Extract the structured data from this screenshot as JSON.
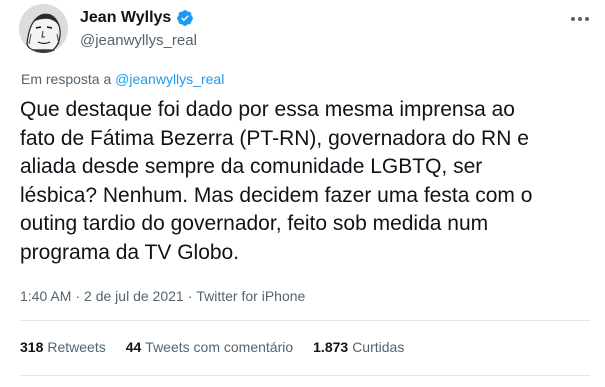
{
  "author": {
    "display_name": "Jean Wyllys",
    "handle": "@jeanwyllys_real",
    "verified": true,
    "avatar_icon": "avatar-portrait",
    "verified_icon": "verified-badge-icon"
  },
  "reply": {
    "prefix": "Em resposta a",
    "to_handle": "@jeanwyllys_real"
  },
  "tweet": {
    "text": "Que destaque foi dado por essa mesma imprensa ao\nfato de Fátima Bezerra (PT-RN), governadora do RN e\naliada desde sempre da comunidade LGBTQ, ser\nlésbica? Nenhum. Mas decidem fazer uma festa com o\nouting tardio do governador, feito sob medida num\nprograma da TV Globo."
  },
  "meta": {
    "time": "1:40 AM",
    "separator": "·",
    "date": "2 de jul de 2021",
    "source": "Twitter for iPhone"
  },
  "stats": {
    "retweets_count": "318",
    "retweets_label": "Retweets",
    "quotes_count": "44",
    "quotes_label": "Tweets com comentário",
    "likes_count": "1.873",
    "likes_label": "Curtidas"
  },
  "colors": {
    "accent": "#1d9bf0",
    "secondary_text": "#536471",
    "primary_text": "#0f1419",
    "divider": "#e1e8ed"
  }
}
